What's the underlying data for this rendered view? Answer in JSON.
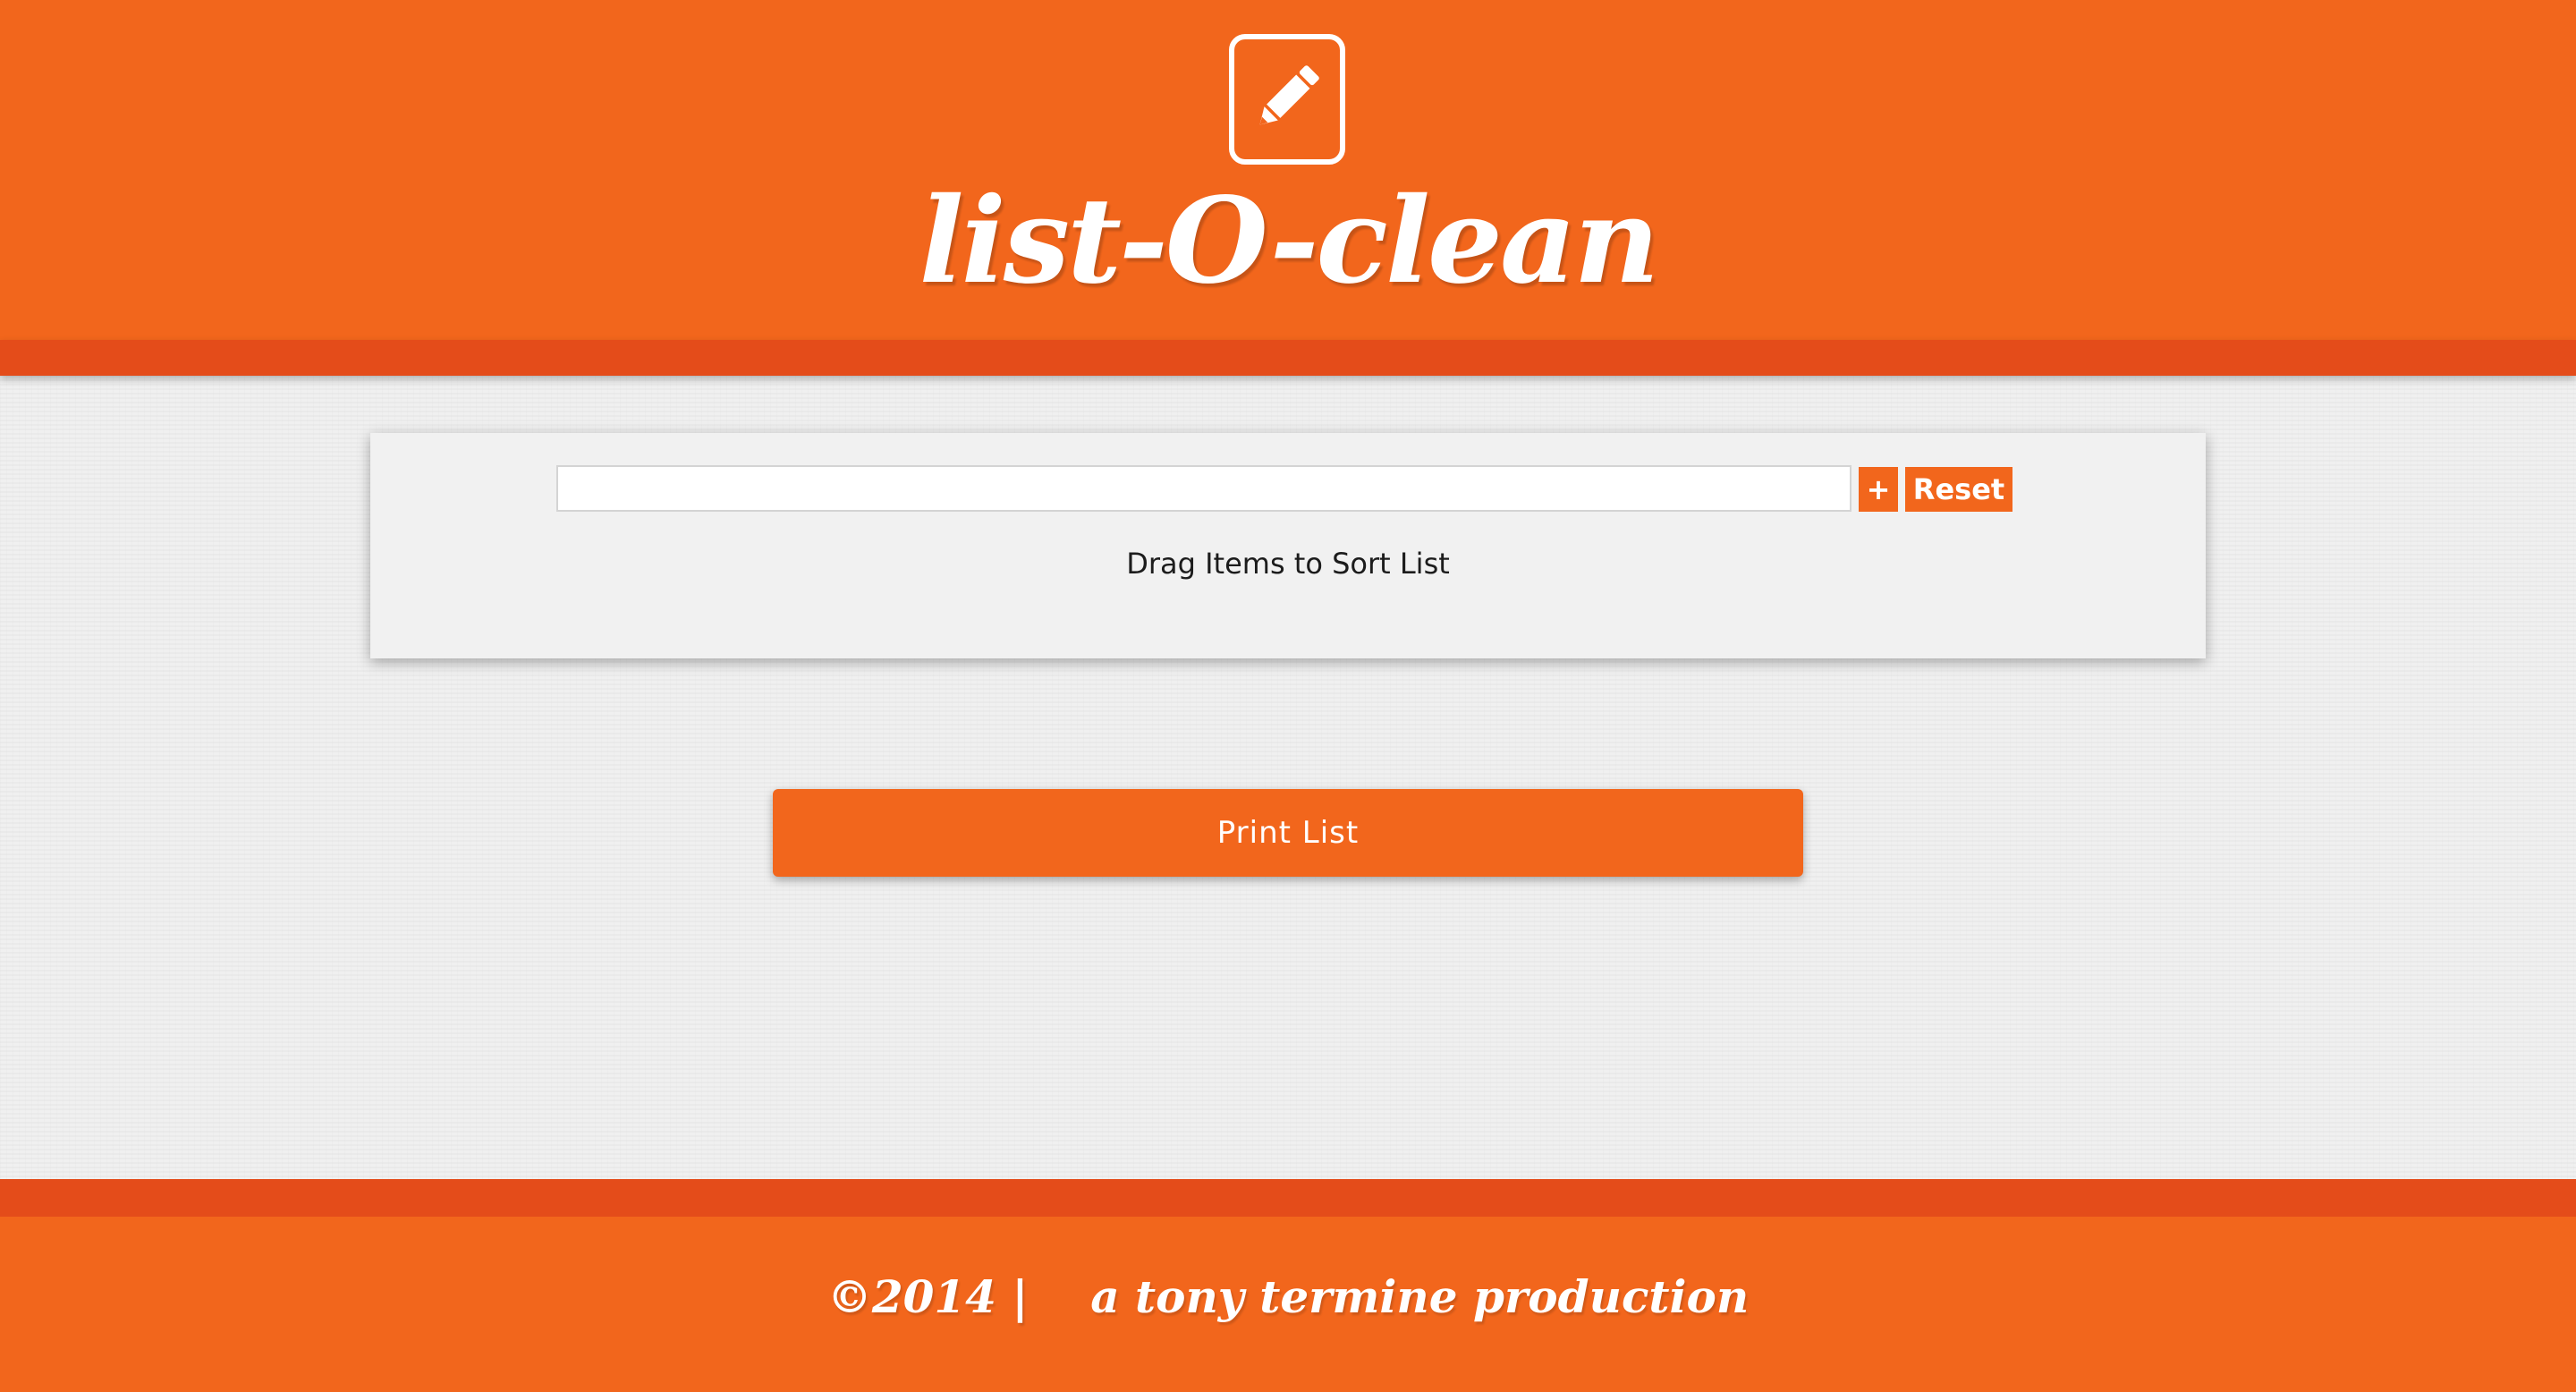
{
  "header": {
    "logo_icon": "pencil-square-icon",
    "title": "list-O-clean"
  },
  "main": {
    "input": {
      "value": "",
      "placeholder": ""
    },
    "add_label": "+",
    "reset_label": "Reset",
    "hint": "Drag Items to Sort List",
    "print_label": "Print List"
  },
  "footer": {
    "copyright": "©2014 |    a tony termine production"
  },
  "colors": {
    "brand_orange": "#f2661c",
    "stripe_orange": "#e44c1a",
    "background": "#efefef",
    "text_dark": "#1c1c1c",
    "text_light": "#ffffff"
  }
}
